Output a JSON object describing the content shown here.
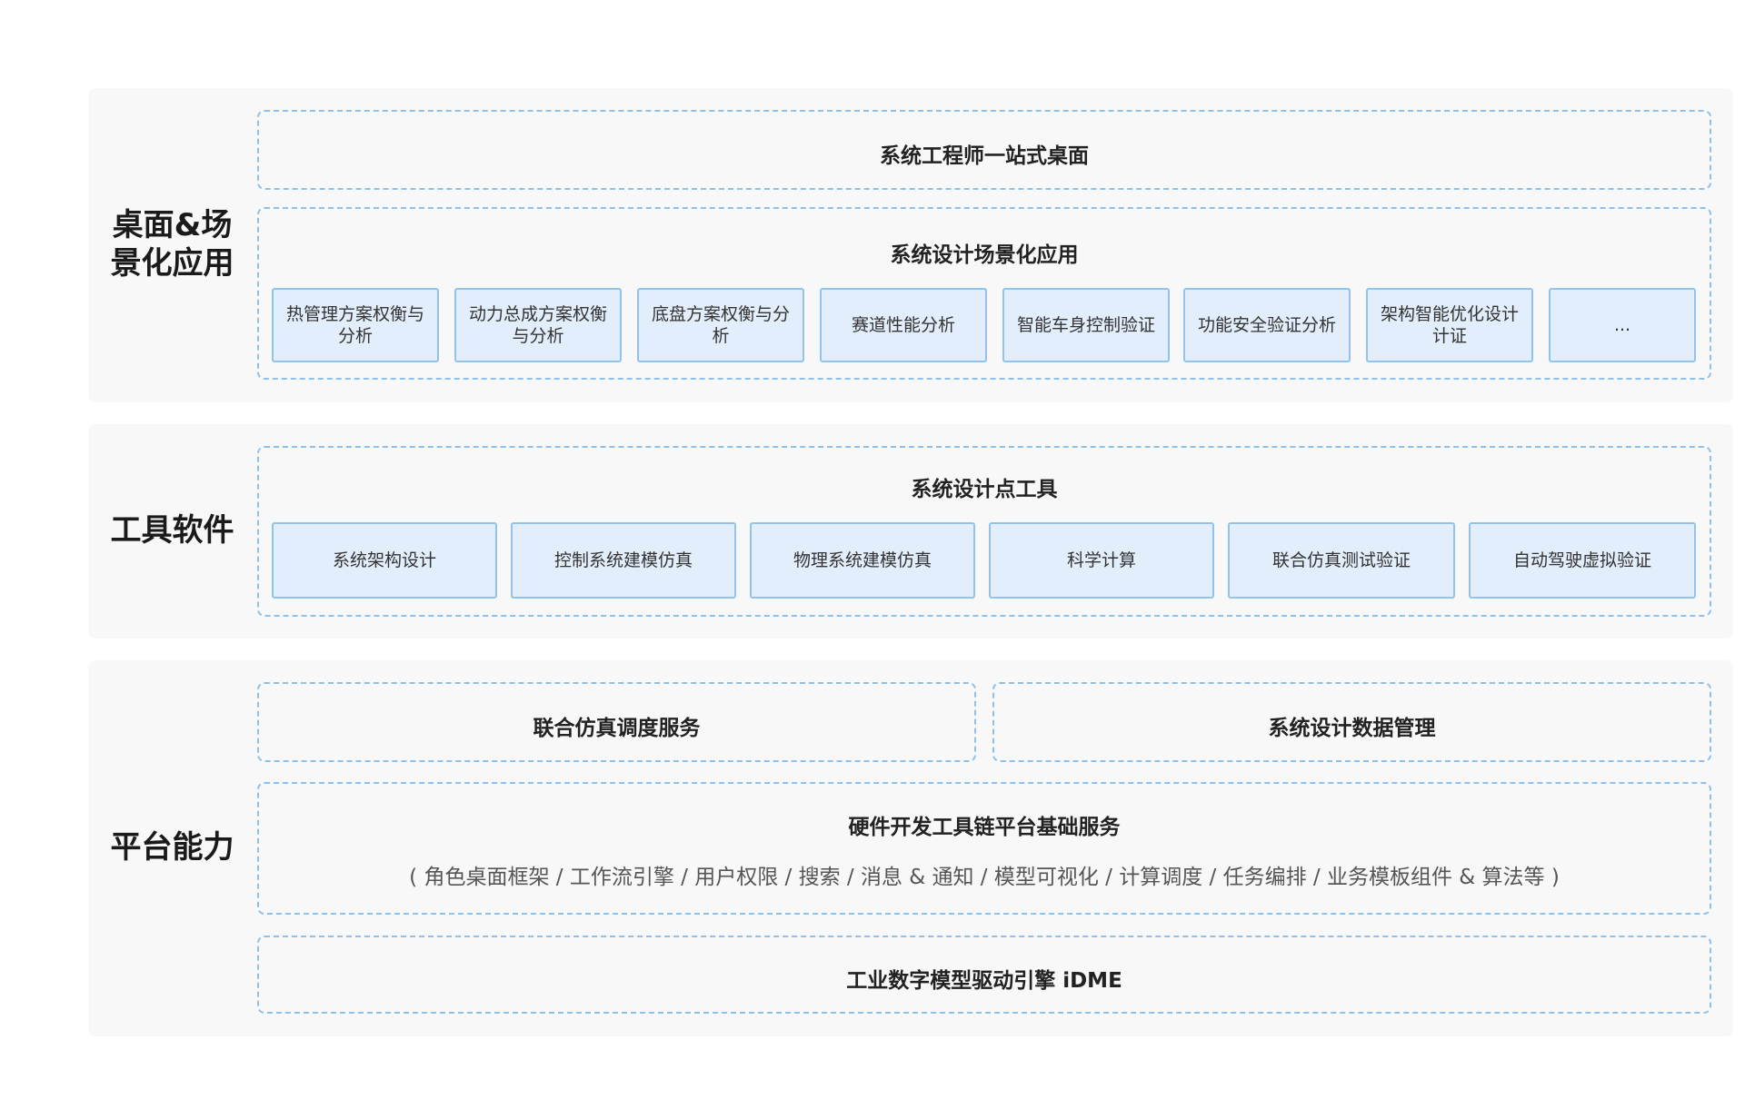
{
  "layers": {
    "desktop": {
      "label": "桌面&场\n景化应用",
      "one_stop_desktop": "系统工程师一站式桌面",
      "scenario_title": "系统设计场景化应用",
      "scenario_items": [
        "热管理方案权衡与分析",
        "动力总成方案权衡与分析",
        "底盘方案权衡与分析",
        "赛道性能分析",
        "智能车身控制验证",
        "功能安全验证分析",
        "架构智能优化设计计证",
        "..."
      ]
    },
    "tools": {
      "label": "工具软件",
      "title": "系统设计点工具",
      "items": [
        "系统架构设计",
        "控制系统建模仿真",
        "物理系统建模仿真",
        "科学计算",
        "联合仿真测试验证",
        "自动驾驶虚拟验证"
      ]
    },
    "platform": {
      "label": "平台能力",
      "cosim_service": "联合仿真调度服务",
      "data_management": "系统设计数据管理",
      "base_services_title": "硬件开发工具链平台基础服务",
      "base_services_detail": "( 角色桌面框架 / 工作流引擎 / 用户权限 / 搜索 / 消息 & 通知 / 模型可视化 / 计算调度 / 任务编排 / 业务模板组件 & 算法等 )",
      "engine": "工业数字模型驱动引擎 iDME"
    }
  }
}
